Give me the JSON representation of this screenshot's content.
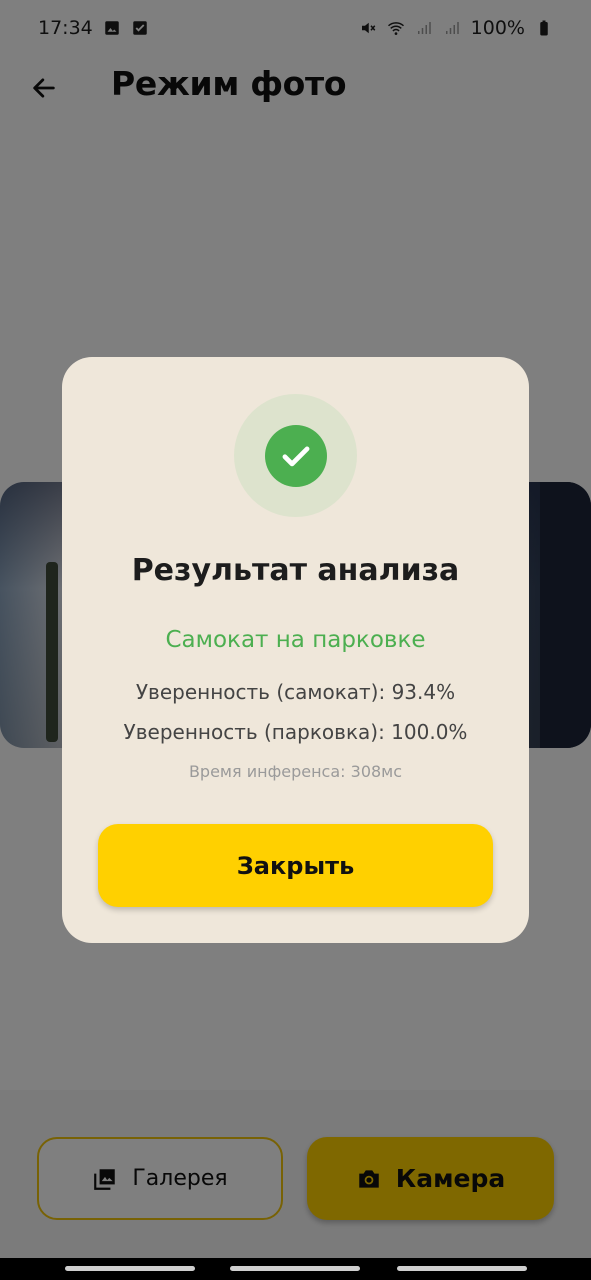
{
  "status_bar": {
    "time": "17:34",
    "battery": "100%",
    "icons": [
      "image-icon",
      "checkbox-icon",
      "mute-icon",
      "wifi-icon",
      "signal-icon",
      "signal-icon",
      "battery-icon"
    ]
  },
  "app_bar": {
    "title": "Режим фото",
    "back_icon": "arrow-back-icon"
  },
  "dialog": {
    "icon": "check-circle-icon",
    "title": "Результат анализа",
    "result": "Самокат на парковке",
    "confidence_scooter": "Уверенность (самокат): 93.4%",
    "confidence_parking": "Уверенность (парковка): 100.0%",
    "inference_time": "Время инференса: 308мс",
    "close_label": "Закрыть"
  },
  "bottom_buttons": {
    "gallery_label": "Галерея",
    "gallery_icon": "photo-library-icon",
    "camera_label": "Камера",
    "camera_icon": "camera-icon"
  },
  "colors": {
    "accent": "#ffd000",
    "success": "#4caf50",
    "dialog_bg": "#efe7da"
  }
}
